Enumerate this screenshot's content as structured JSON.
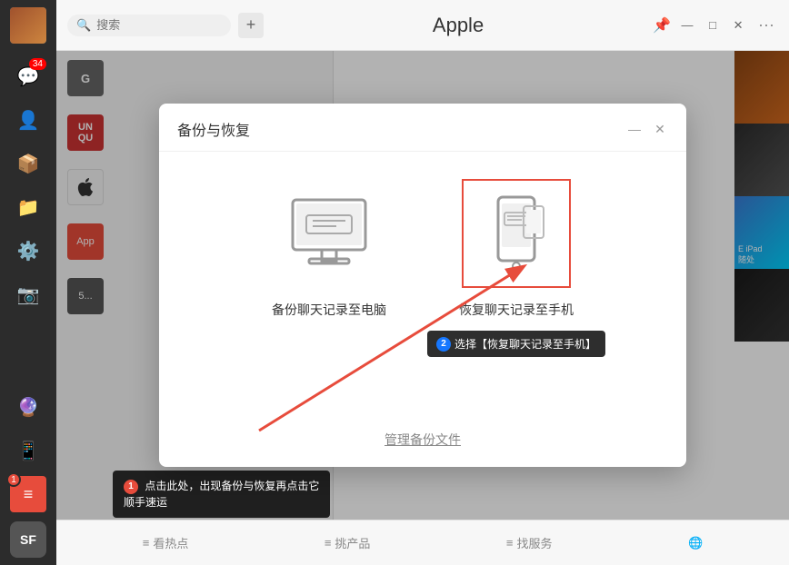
{
  "sidebar": {
    "badge": "34",
    "items": [
      {
        "id": "chat",
        "icon": "💬",
        "label": "聊天"
      },
      {
        "id": "contacts",
        "icon": "👤",
        "label": "联系人"
      },
      {
        "id": "store",
        "icon": "📦",
        "label": "应用"
      },
      {
        "id": "files",
        "icon": "📁",
        "label": "文件"
      },
      {
        "id": "settings",
        "icon": "⚙️",
        "label": "设置"
      },
      {
        "id": "photo",
        "icon": "📷",
        "label": "相册"
      },
      {
        "id": "mini",
        "icon": "🔮",
        "label": "小程序"
      },
      {
        "id": "phone",
        "icon": "📱",
        "label": "手机"
      }
    ],
    "bottom_icon": "≡",
    "bottom_badge": "1",
    "sf_label": "SF"
  },
  "topbar": {
    "search_placeholder": "搜索",
    "title": "Apple",
    "add_icon": "+",
    "pin_icon": "📌",
    "more_label": "···"
  },
  "modal": {
    "title": "备份与恢复",
    "minimize_icon": "—",
    "close_icon": "✕",
    "option_backup_label": "备份聊天记录至电脑",
    "option_restore_label": "恢复聊天记录至手机",
    "manage_label": "管理备份文件",
    "tooltip_badge": "2",
    "tooltip_text": "选择【恢复聊天记录至手机】"
  },
  "tooltip_bottom": {
    "badge": "1",
    "text": "点击此处，出现备份与恢复再点击它\n顺手速运"
  },
  "bottombar": {
    "tabs": [
      {
        "icon": "≡",
        "label": "看热点"
      },
      {
        "icon": "≡",
        "label": "挑产品"
      },
      {
        "icon": "≡",
        "label": "找服务"
      },
      {
        "icon": "🌐",
        "label": ""
      }
    ]
  },
  "colors": {
    "accent_red": "#e74c3c",
    "highlight_blue": "#1677ff",
    "bg_dark": "#2c2c2c"
  }
}
